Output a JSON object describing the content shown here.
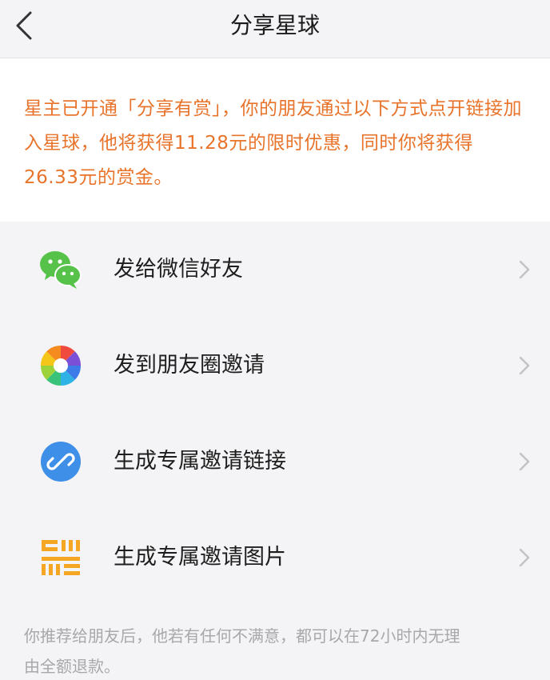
{
  "header": {
    "title": "分享星球"
  },
  "notice": {
    "text": "星主已开通「分享有赏」，你的朋友通过以下方式点开链接加入星球，他将获得11.28元的限时优惠，同时你将获得26.33元的赏金。"
  },
  "menu": {
    "items": [
      {
        "label": "发给微信好友",
        "icon": "wechat-icon"
      },
      {
        "label": "发到朋友圈邀请",
        "icon": "moments-icon"
      },
      {
        "label": "生成专属邀请链接",
        "icon": "link-icon"
      },
      {
        "label": "生成专属邀请图片",
        "icon": "image-icon"
      }
    ]
  },
  "footer": {
    "note": "你推荐给朋友后，他若有任何不满意，都可以在72小时内无理由全额退款。"
  },
  "colors": {
    "accent_orange": "#e8732a",
    "wechat_green": "#56c24a",
    "link_blue": "#3d8fe8",
    "image_orange": "#f5a623"
  }
}
